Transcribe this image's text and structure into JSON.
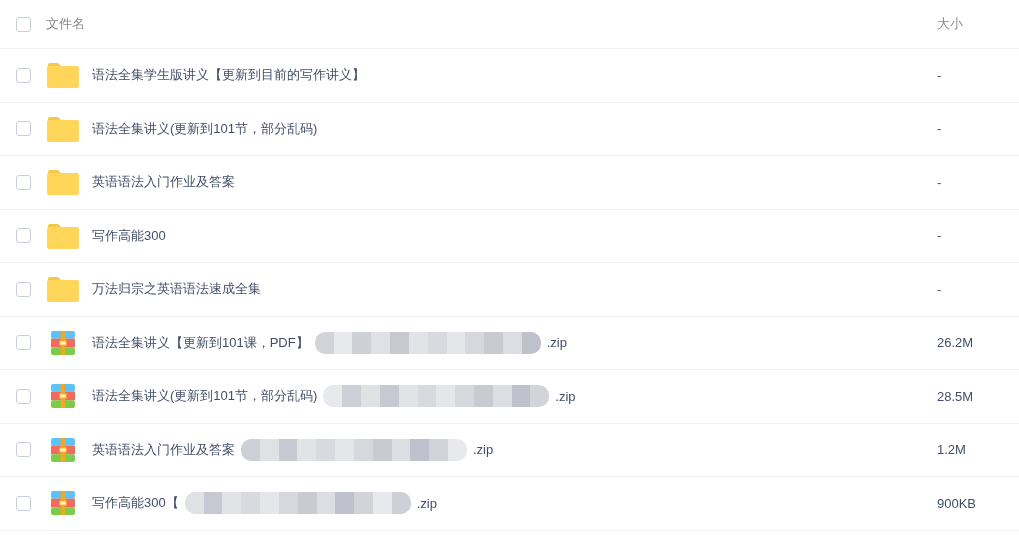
{
  "header": {
    "checked": false,
    "name_label": "文件名",
    "size_label": "大小"
  },
  "files": [
    {
      "kind": "folder",
      "checked": false,
      "name": "语法全集学生版讲义【更新到目前的写作讲义】",
      "redacted": false,
      "size": "-"
    },
    {
      "kind": "folder",
      "checked": false,
      "name": "语法全集讲义(更新到101节，部分乱码)",
      "redacted": false,
      "size": "-"
    },
    {
      "kind": "folder",
      "checked": false,
      "name": "英语语法入门作业及答案",
      "redacted": false,
      "size": "-"
    },
    {
      "kind": "folder",
      "checked": false,
      "name": "写作高能300",
      "redacted": false,
      "size": "-"
    },
    {
      "kind": "folder",
      "checked": false,
      "name": "万法归宗之英语语法速成全集",
      "redacted": false,
      "size": "-"
    },
    {
      "kind": "zip",
      "checked": false,
      "name": "语法全集讲义【更新到101课，PDF】",
      "redacted": true,
      "suffix": ".zip",
      "size": "26.2M"
    },
    {
      "kind": "zip",
      "checked": false,
      "name": "语法全集讲义(更新到101节，部分乱码)",
      "redacted": true,
      "suffix": ".zip",
      "size": "28.5M"
    },
    {
      "kind": "zip",
      "checked": false,
      "name": "英语语法入门作业及答案",
      "redacted": true,
      "suffix": ".zip",
      "size": "1.2M"
    },
    {
      "kind": "zip",
      "checked": false,
      "name": "写作高能300【",
      "redacted": true,
      "suffix": ".zip",
      "size": "900KB"
    }
  ]
}
